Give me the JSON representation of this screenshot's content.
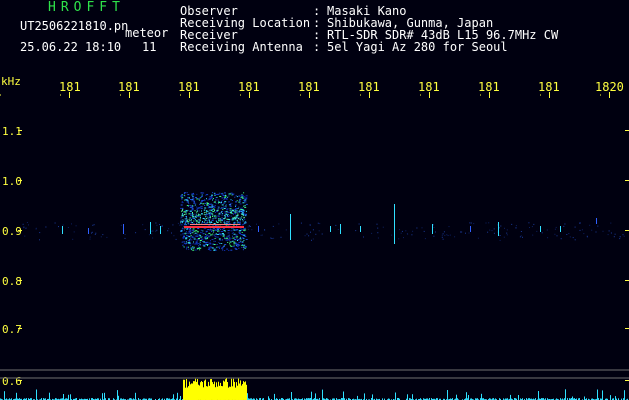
{
  "header": {
    "app_title": "HROFFT",
    "file_name": "UT2506221810.pn",
    "event_type": "meteor",
    "date_time": "25.06.22 18:10",
    "event_count": "11"
  },
  "info": {
    "observer_label": "Observer",
    "observer_value": "Masaki Kano",
    "location_label": "Receiving Location",
    "location_value": "Shibukawa, Gunma, Japan",
    "receiver_label": "Receiver",
    "receiver_value": "RTL-SDR SDR# 43dB L15 96.7MHz CW",
    "antenna_label": "Receiving Antenna",
    "antenna_value": "5el Yagi Az 280 for Seoul",
    "colon": ":"
  },
  "axis": {
    "unit_label": "kHz",
    "x_ticks": [
      "181",
      "181",
      "181",
      "181",
      "181",
      "181",
      "181",
      "181",
      "181",
      "1820"
    ],
    "y_ticks": [
      "1.1",
      "1.0",
      "0.9",
      "0.8",
      "0.7",
      "0.6"
    ]
  },
  "colors": {
    "background": "#000010",
    "title_green": "#2ee24a",
    "tick_yellow": "#ffff40",
    "signal_red": "#ff3040",
    "signal_cyan": "#30e0ff",
    "signal_yellow": "#ffff00"
  }
}
